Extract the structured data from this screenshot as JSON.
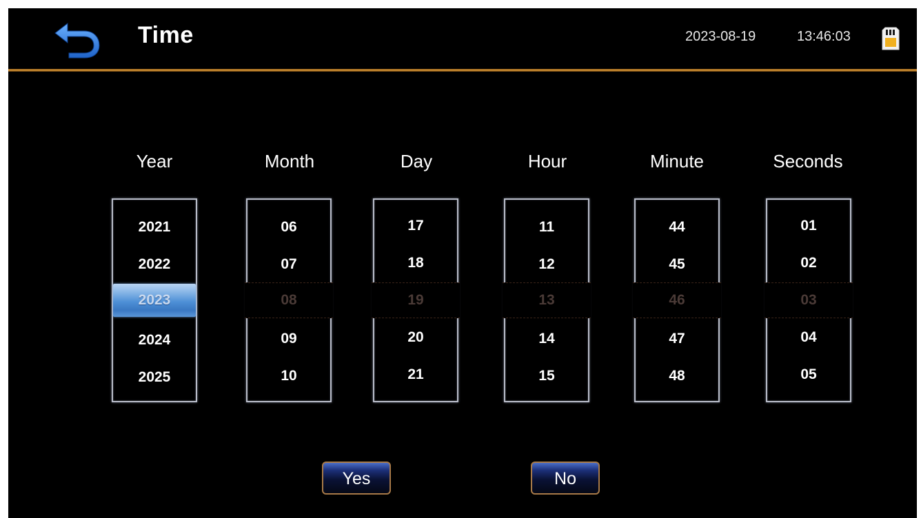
{
  "header": {
    "title": "Time",
    "date": "2023-08-19",
    "time": "13:46:03",
    "back_icon": "back-arrow-icon",
    "status_icon": "sd-card-icon"
  },
  "colors": {
    "background": "#000000",
    "divider": "#d89a3a",
    "back_icon": "#2f7fe0",
    "selection": "#4d8fd6",
    "button_border": "#a87a48"
  },
  "pickers": [
    {
      "label": "Year",
      "items": [
        "2021",
        "2022",
        "2023",
        "2024",
        "2025"
      ],
      "selected": "2023"
    },
    {
      "label": "Month",
      "items": [
        "06",
        "07",
        "08",
        "09",
        "10"
      ],
      "selected": "08"
    },
    {
      "label": "Day",
      "items": [
        "17",
        "18",
        "19",
        "20",
        "21"
      ],
      "selected": "19"
    },
    {
      "label": "Hour",
      "items": [
        "11",
        "12",
        "13",
        "14",
        "15"
      ],
      "selected": "13"
    },
    {
      "label": "Minute",
      "items": [
        "44",
        "45",
        "46",
        "47",
        "48"
      ],
      "selected": "46"
    },
    {
      "label": "Seconds",
      "items": [
        "01",
        "02",
        "03",
        "04",
        "05"
      ],
      "selected": "03"
    }
  ],
  "buttons": {
    "yes_label": "Yes",
    "no_label": "No"
  }
}
